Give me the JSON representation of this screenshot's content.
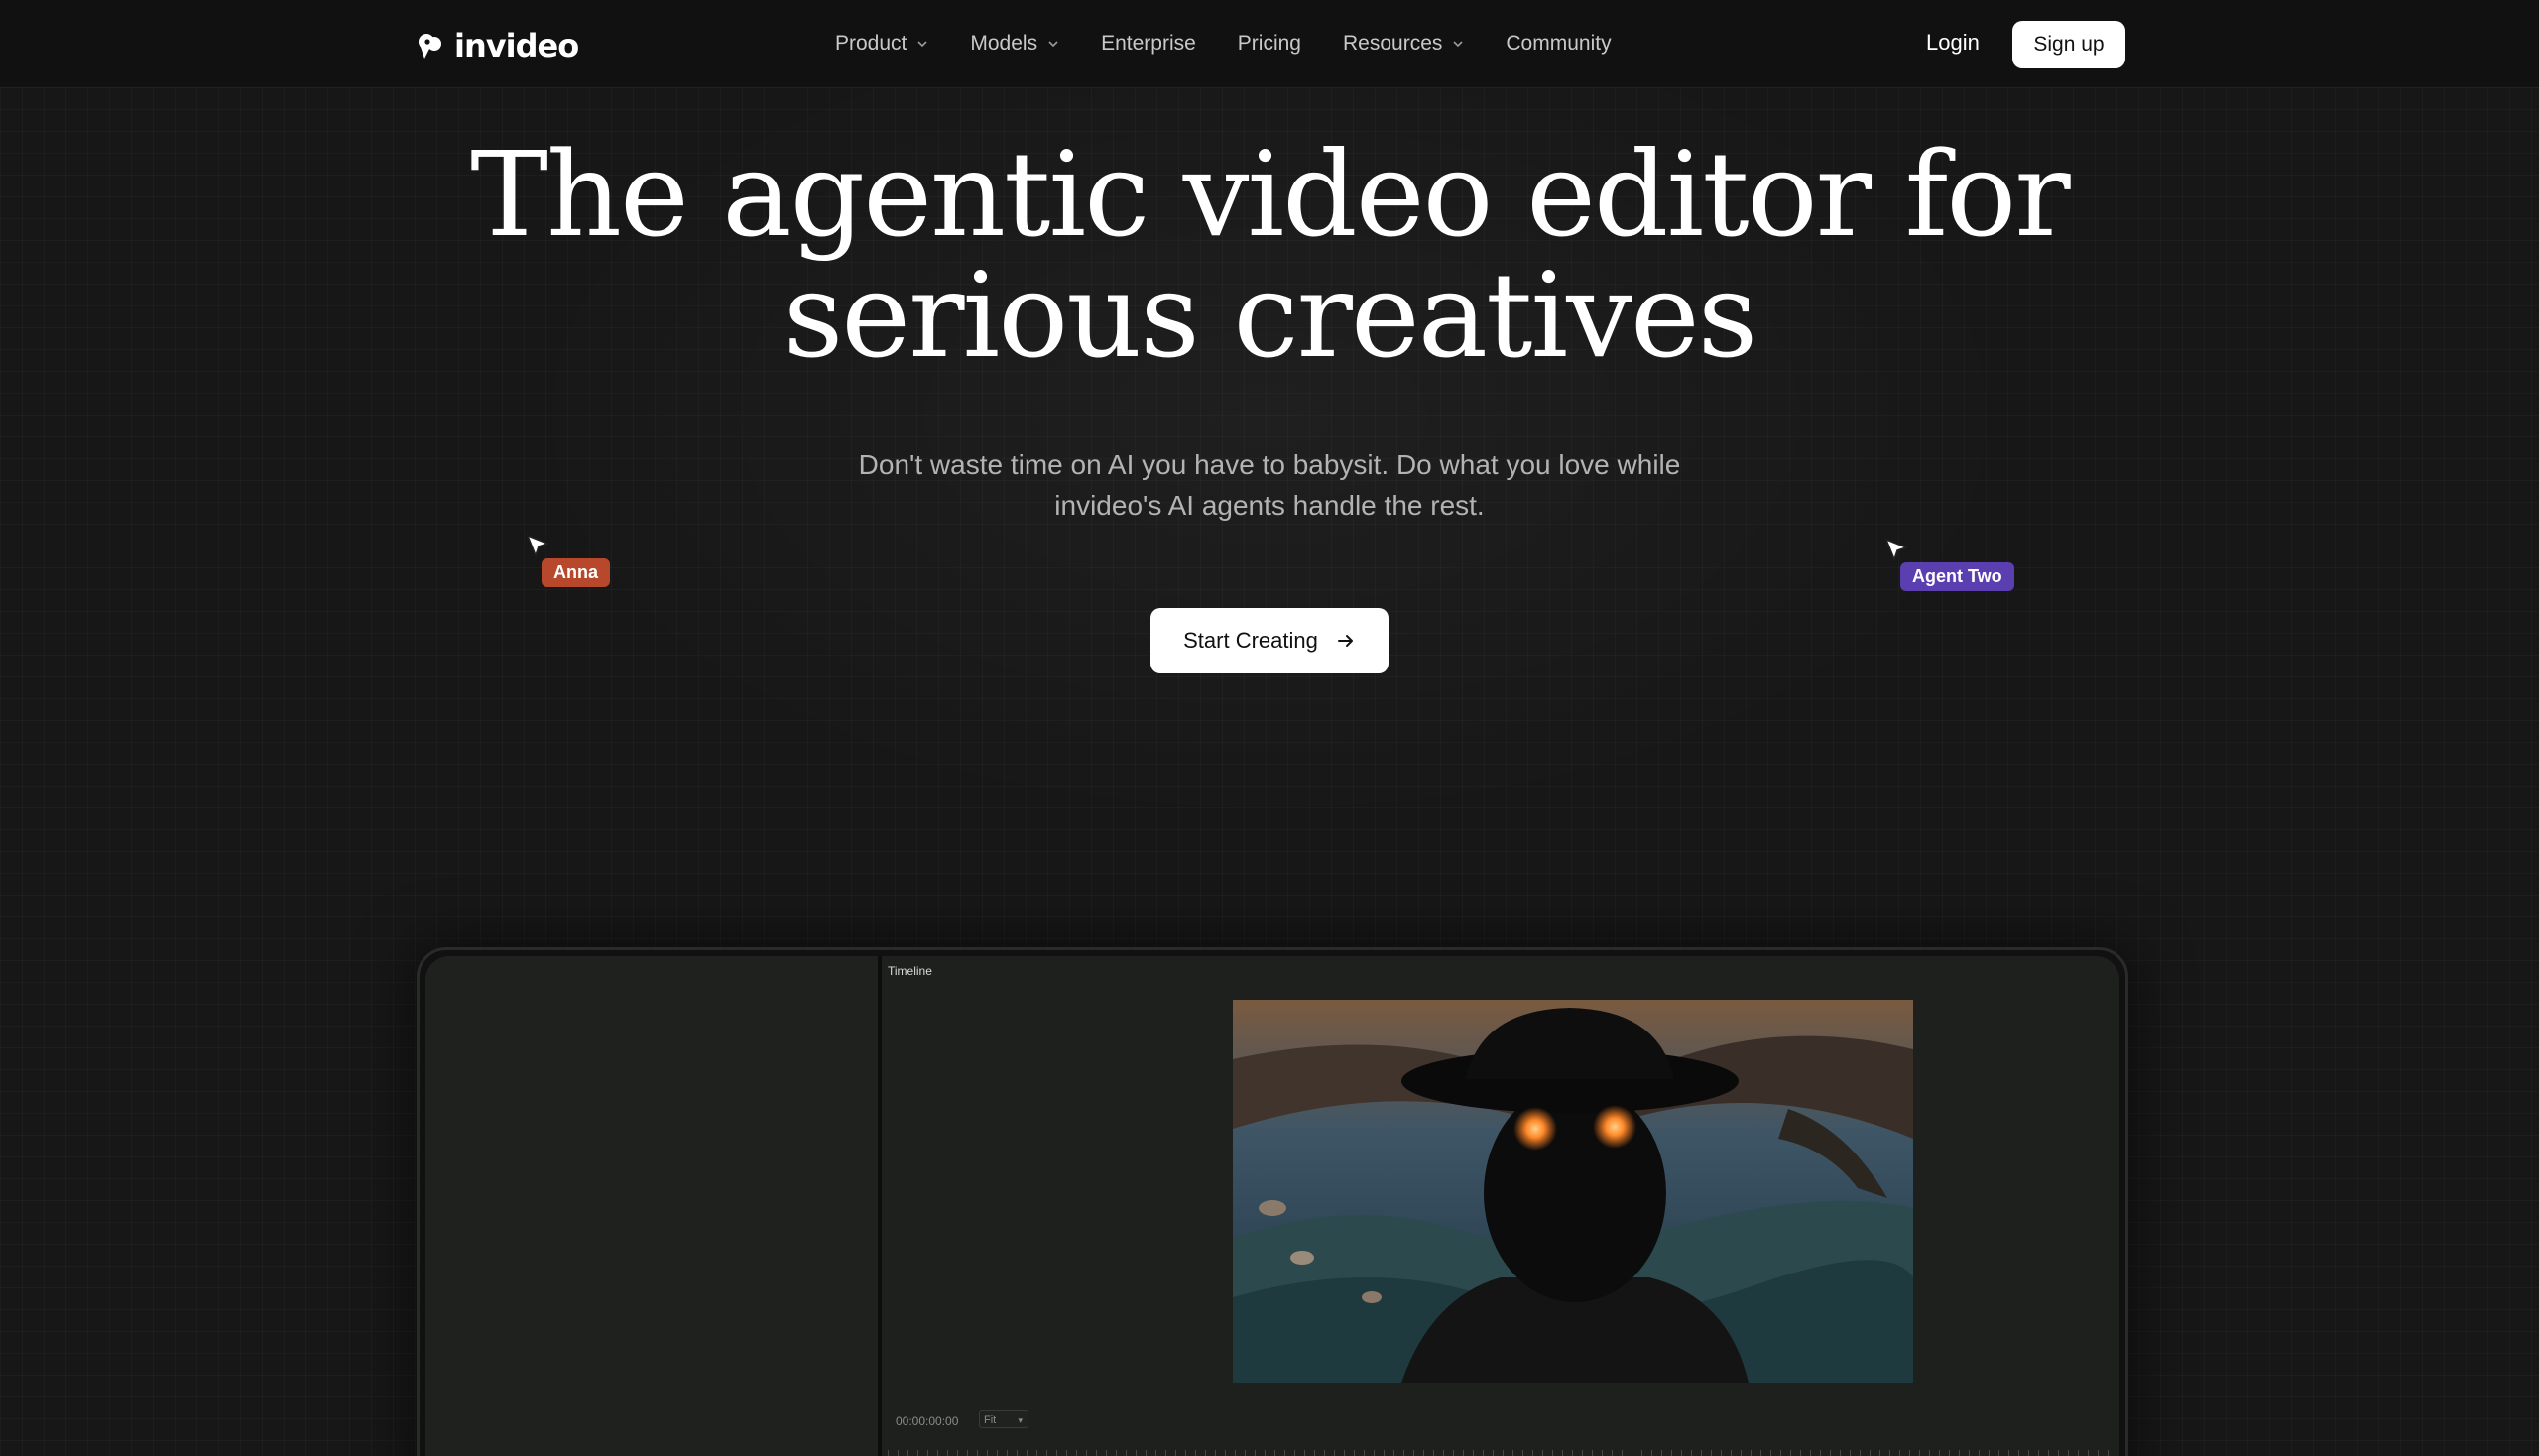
{
  "nav": {
    "logo_text": "invideo",
    "items": [
      {
        "label": "Product",
        "has_dropdown": true
      },
      {
        "label": "Models",
        "has_dropdown": true
      },
      {
        "label": "Enterprise",
        "has_dropdown": false
      },
      {
        "label": "Pricing",
        "has_dropdown": false
      },
      {
        "label": "Resources",
        "has_dropdown": true
      },
      {
        "label": "Community",
        "has_dropdown": false
      }
    ],
    "login_label": "Login",
    "signup_label": "Sign up"
  },
  "hero": {
    "headline_line1": "The agentic video editor for",
    "headline_line2": "serious creatives",
    "subtitle_line1": "Don't waste time on AI you have to babysit. Do what you love while",
    "subtitle_line2": "invideo's AI agents handle the rest.",
    "cta_label": "Start Creating"
  },
  "cursors": [
    {
      "name": "Anna",
      "color": "#b8482c"
    },
    {
      "name": "Agent Two",
      "color": "#5b3fb0"
    }
  ],
  "editor": {
    "timeline_label": "Timeline",
    "timecode": "00:00:00:00",
    "fit_option": "Fit"
  },
  "colors": {
    "background": "#171717",
    "nav_background": "#111111",
    "button_bg": "#ffffff",
    "button_text": "#111111"
  },
  "icons": {
    "logo": "invideo-logo-icon",
    "dropdown": "chevron-down-icon",
    "cta_arrow": "arrow-right-icon",
    "cursor": "cursor-pointer-icon"
  }
}
